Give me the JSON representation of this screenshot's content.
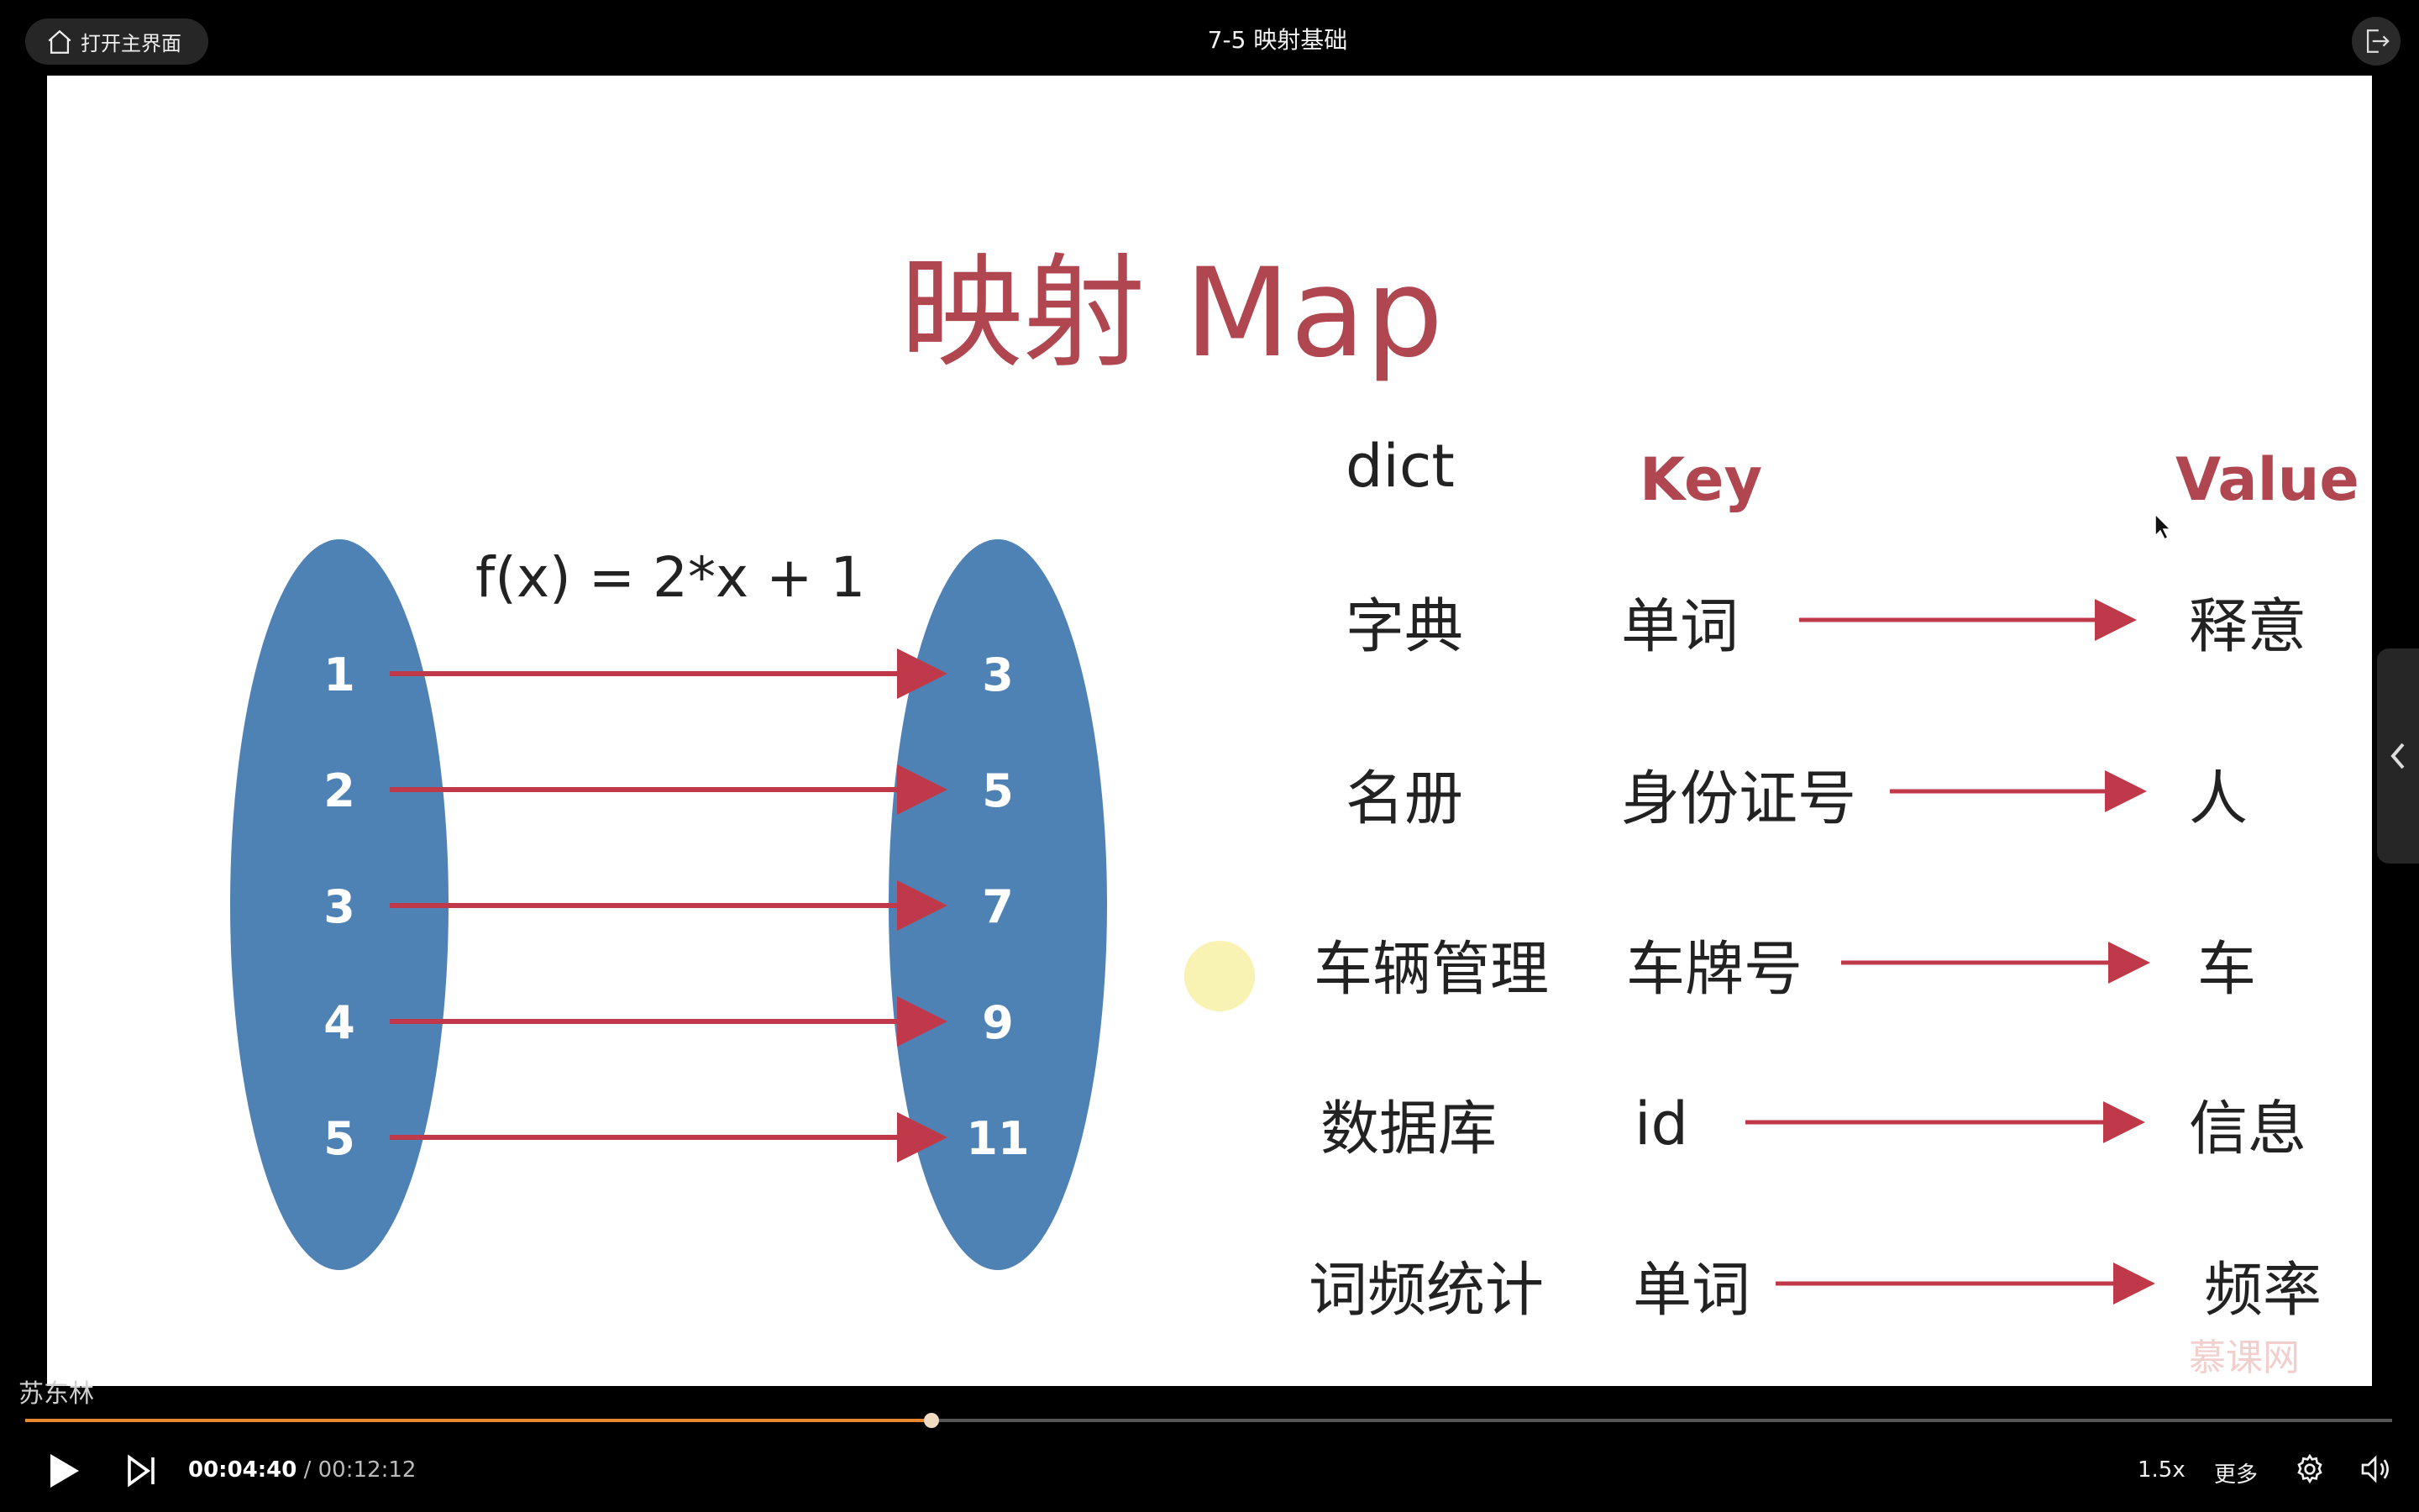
{
  "topbar": {
    "home_label": "打开主界面",
    "title": "7-5 映射基础",
    "home_icon": "home-icon",
    "exit_icon": "exit-icon"
  },
  "slide": {
    "title": "映射 Map",
    "formula": "f(x) = 2*x + 1",
    "domain_values": [
      "1",
      "2",
      "3",
      "4",
      "5"
    ],
    "range_values": [
      "3",
      "5",
      "7",
      "9",
      "11"
    ],
    "table": {
      "col_dict": "dict",
      "col_key": "Key",
      "col_value": "Value",
      "rows": [
        {
          "dict": "字典",
          "key": "单词",
          "value": "释意"
        },
        {
          "dict": "名册",
          "key": "身份证号",
          "value": "人"
        },
        {
          "dict": "车辆管理",
          "key": "车牌号",
          "value": "车"
        },
        {
          "dict": "数据库",
          "key": "id",
          "value": "信息"
        },
        {
          "dict": "词频统计",
          "key": "单词",
          "value": "频率"
        }
      ]
    },
    "watermark": "慕课网",
    "colors": {
      "accent": "#b04650",
      "ellipse": "#4f82b4",
      "arrow": "#c0394a"
    }
  },
  "uploader": "苏东林",
  "player": {
    "current_time": "00:04:40",
    "separator": " / ",
    "duration": "00:12:12",
    "progress_fraction": 0.383,
    "speed": "1.5x",
    "more": "更多",
    "play_icon": "play-icon",
    "next_icon": "next-icon",
    "settings_icon": "gear-icon",
    "volume_icon": "volume-icon",
    "progress_color": "#e8892e"
  }
}
